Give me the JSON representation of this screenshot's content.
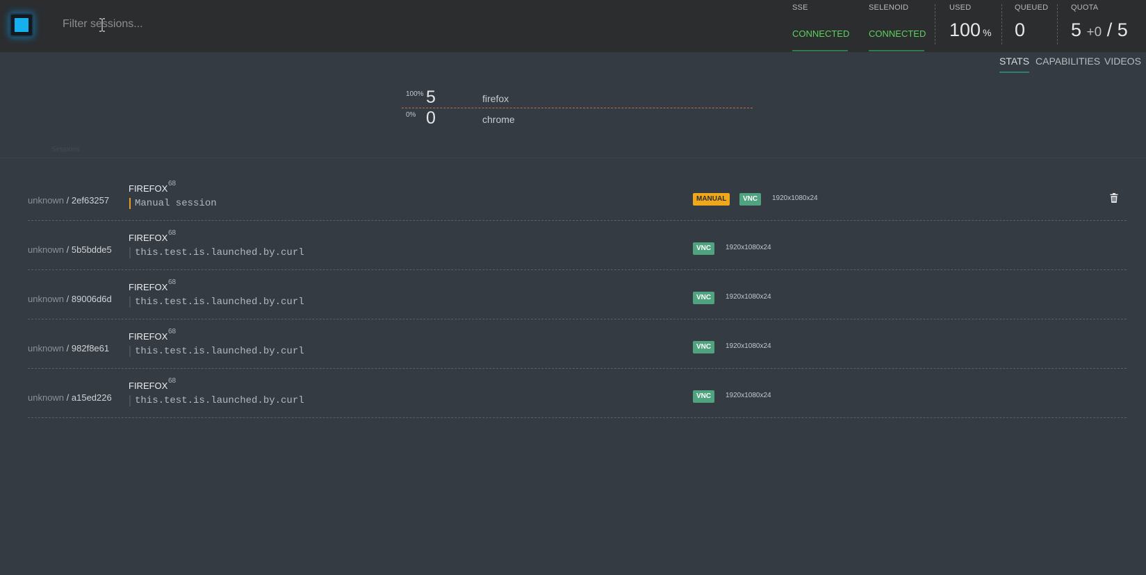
{
  "header": {
    "filter_placeholder": "Filter sessions...",
    "sse": {
      "label": "SSE",
      "status": "CONNECTED"
    },
    "selenoid": {
      "label": "SELENOID",
      "status": "CONNECTED"
    },
    "used": {
      "label": "USED",
      "value": "100",
      "unit": "%"
    },
    "queued": {
      "label": "QUEUED",
      "value": "0"
    },
    "quota": {
      "label": "QUOTA",
      "used": "5",
      "plus": "+",
      "pending": "0",
      "slash": "/",
      "total": "5"
    }
  },
  "tabs": [
    {
      "label": "STATS",
      "active": true
    },
    {
      "label": "CAPABILITIES",
      "active": false
    },
    {
      "label": "VIDEOS",
      "active": false
    }
  ],
  "browser_stats": [
    {
      "percent": "100%",
      "count": "5",
      "name": "firefox"
    },
    {
      "percent": "0%",
      "count": "0",
      "name": "chrome"
    }
  ],
  "sessions_caption": "Sessions",
  "sessions": [
    {
      "quota": "unknown",
      "sep": " / ",
      "id": "2ef63257",
      "browser": "FIREFOX",
      "version": "68",
      "name": "Manual session",
      "manual": true,
      "manual_label": "MANUAL",
      "vnc_label": "VNC",
      "resolution": "1920x1080x24"
    },
    {
      "quota": "unknown",
      "sep": " / ",
      "id": "5b5bdde5",
      "browser": "FIREFOX",
      "version": "68",
      "name": "this.test.is.launched.by.curl",
      "manual": false,
      "vnc_label": "VNC",
      "resolution": "1920x1080x24"
    },
    {
      "quota": "unknown",
      "sep": " / ",
      "id": "89006d6d",
      "browser": "FIREFOX",
      "version": "68",
      "name": "this.test.is.launched.by.curl",
      "manual": false,
      "vnc_label": "VNC",
      "resolution": "1920x1080x24"
    },
    {
      "quota": "unknown",
      "sep": " / ",
      "id": "982f8e61",
      "browser": "FIREFOX",
      "version": "68",
      "name": "this.test.is.launched.by.curl",
      "manual": false,
      "vnc_label": "VNC",
      "resolution": "1920x1080x24"
    },
    {
      "quota": "unknown",
      "sep": " / ",
      "id": "a15ed226",
      "browser": "FIREFOX",
      "version": "68",
      "name": "this.test.is.launched.by.curl",
      "manual": false,
      "vnc_label": "VNC",
      "resolution": "1920x1080x24"
    }
  ],
  "colors": {
    "background": "#353b42",
    "header_bg": "#2b2d2f",
    "connected": "#5fd15f",
    "accent_logo": "#17b0ee",
    "manual_badge": "#f0a81a",
    "vnc_badge": "#4fa37e",
    "divider_orange": "#c96a4b"
  },
  "icons": [
    "logo-icon",
    "text-cursor-icon",
    "trash-icon"
  ]
}
